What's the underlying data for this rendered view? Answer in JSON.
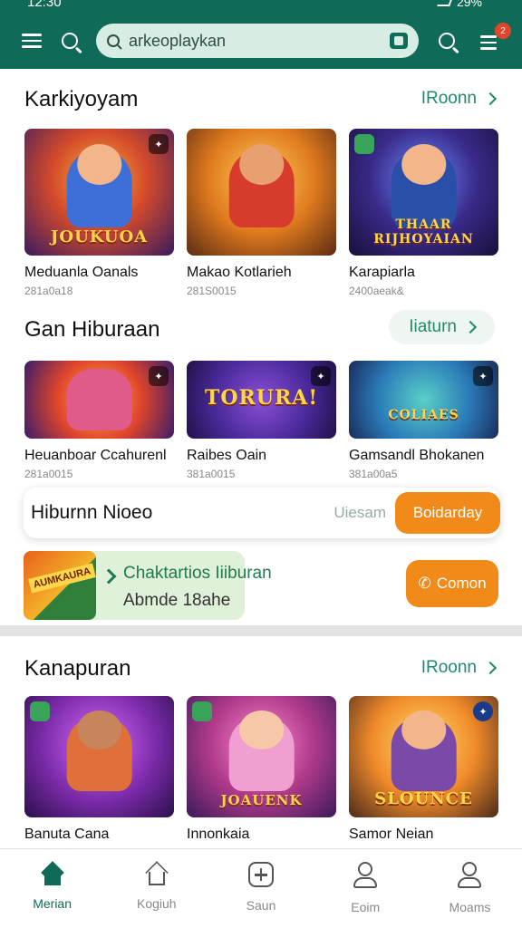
{
  "status": {
    "time": "12:30",
    "battery": "29%"
  },
  "search": {
    "value": "arkeoplaykan"
  },
  "cart": {
    "badge": "2"
  },
  "sections": [
    {
      "title": "Karkiyoyam",
      "see_all": "IRoonn",
      "items": [
        {
          "name": "Meduanla Oanals",
          "meta": "281a0a18",
          "art": "JOUKUOA"
        },
        {
          "name": "Makao Kotlarieh",
          "meta": "281S0015",
          "art": ""
        },
        {
          "name": "Karapiarla",
          "meta": "2400aeak&",
          "art": "THAAR RIJHOYAIAN"
        }
      ]
    },
    {
      "title": "Gan Hiburaan",
      "see_all": "Iiaturn",
      "items": [
        {
          "name": "Heuanboar Ccahurenl",
          "meta": "281a0015",
          "art": ""
        },
        {
          "name": "Raibes Oain",
          "meta": "381a0015",
          "art": "TORURA!"
        },
        {
          "name": "Gamsandl Bhokanen",
          "meta": "381a00a5",
          "art": "COLIAES"
        }
      ]
    },
    {
      "title": "Kanapuran",
      "see_all": "IRoonn",
      "items": [
        {
          "name": "Banuta Cana",
          "meta": "",
          "art": ""
        },
        {
          "name": "Innonkaia",
          "meta": "",
          "art": "JOAUENK"
        },
        {
          "name": "Samor Neian",
          "meta": "",
          "art": "SLOUNCE"
        }
      ]
    }
  ],
  "video_bar": {
    "title": "Hiburnn Nioeo",
    "hint": "Uiesam",
    "button": "Boidarday"
  },
  "promo": {
    "line1": "Chaktartios Iiiburan",
    "line2": "Abmde 18ahe",
    "badge": "AUMKAURA",
    "button": "Comon"
  },
  "nav": [
    {
      "label": "Merian",
      "icon": "home-icon"
    },
    {
      "label": "Kogiuh",
      "icon": "home-outline-icon"
    },
    {
      "label": "Saun",
      "icon": "gamepad-icon"
    },
    {
      "label": "Eoim",
      "icon": "user-icon"
    },
    {
      "label": "Moams",
      "icon": "profile-icon"
    }
  ],
  "colors": {
    "primary": "#0f6b57",
    "accent": "#f28a1a",
    "link": "#1f8a6e"
  }
}
